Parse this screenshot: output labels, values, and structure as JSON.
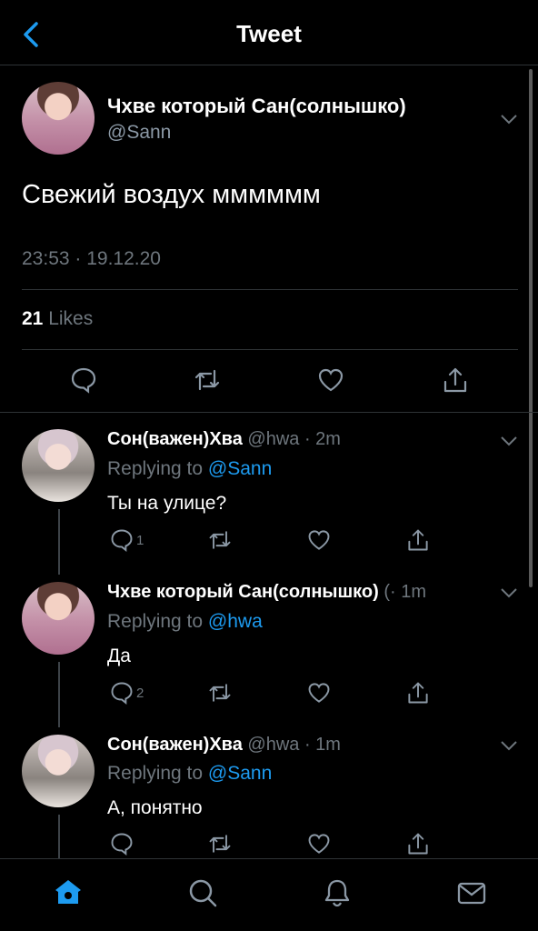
{
  "header": {
    "title": "Tweet",
    "back_icon": "chevron-left-icon",
    "accent": "#1d9bf0"
  },
  "main_tweet": {
    "name": "Чхве который Сан(солнышко)",
    "handle": "@Sann",
    "text": "Свежий воздух мммммм",
    "timestamp": "23:53 · 19.12.20",
    "likes_count": "21",
    "likes_label": "Likes"
  },
  "replies": [
    {
      "name": "Сон(важен)Хва",
      "meta": "@hwa · 2m",
      "replying_label": "Replying to",
      "mention": "@Sann",
      "text": "Ты на улице?",
      "reply_count": "1"
    },
    {
      "name": "Чхве который Сан(солнышко)",
      "meta": "(· 1m",
      "replying_label": "Replying to",
      "mention": "@hwa",
      "text": "Да",
      "reply_count": "2"
    },
    {
      "name": "Сон(важен)Хва",
      "meta": "@hwa · 1m",
      "replying_label": "Replying to",
      "mention": "@Sann",
      "text": "А, понятно",
      "reply_count": ""
    }
  ],
  "tabbar": {
    "items": [
      "home-icon",
      "search-icon",
      "notifications-icon",
      "messages-icon"
    ],
    "active": "home-icon"
  }
}
